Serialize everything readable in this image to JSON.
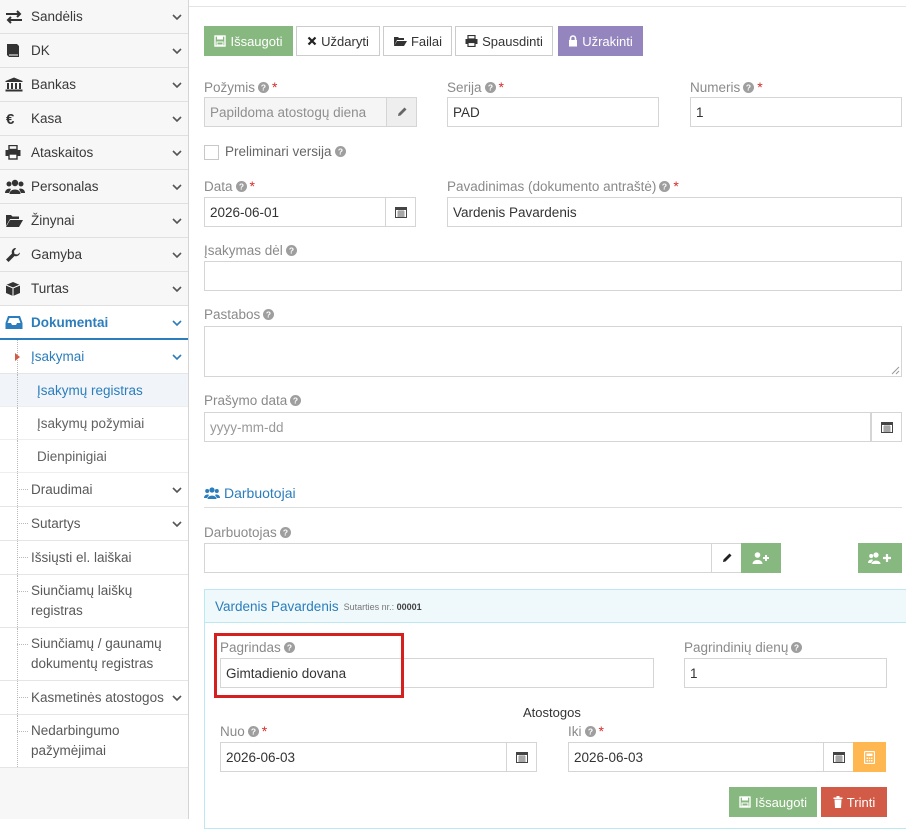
{
  "sidebar": {
    "items": [
      {
        "label": "Sandėlis",
        "icon": "exchange-icon"
      },
      {
        "label": "DK",
        "icon": "book-icon"
      },
      {
        "label": "Bankas",
        "icon": "bank-icon"
      },
      {
        "label": "Kasa",
        "icon": "euro-icon"
      },
      {
        "label": "Ataskaitos",
        "icon": "print-icon"
      },
      {
        "label": "Personalas",
        "icon": "users-icon"
      },
      {
        "label": "Žinynai",
        "icon": "folder-open-icon"
      },
      {
        "label": "Gamyba",
        "icon": "wrench-icon"
      },
      {
        "label": "Turtas",
        "icon": "cube-icon"
      },
      {
        "label": "Dokumentai",
        "icon": "inbox-icon"
      }
    ],
    "submenu": {
      "open_label": "Įsakymai",
      "children": [
        "Įsakymų registras",
        "Įsakymų požymiai",
        "Dienpinigiai"
      ],
      "items": [
        "Draudimai",
        "Sutartys",
        "Išsiųsti el. laiškai",
        "Siunčiamų laiškų registras",
        "Siunčiamų / gaunamų dokumentų registras",
        "Kasmetinės atostogos",
        "Nedarbingumo pažymėjimai"
      ]
    }
  },
  "toolbar": {
    "save": "Išsaugoti",
    "close": "Uždaryti",
    "files": "Failai",
    "print": "Spausdinti",
    "lock": "Užrakinti"
  },
  "form": {
    "pozymis": {
      "label": "Požymis",
      "value": "Papildoma atostogų diena"
    },
    "serija": {
      "label": "Serija",
      "value": "PAD"
    },
    "numeris": {
      "label": "Numeris",
      "value": "1"
    },
    "preliminari": {
      "label": "Preliminari versija",
      "checked": false
    },
    "data": {
      "label": "Data",
      "value": "2026-06-01"
    },
    "pavadinimas": {
      "label": "Pavadinimas (dokumento antraštė)",
      "value": "Vardenis Pavardenis"
    },
    "isakymas_del": {
      "label": "Įsakymas dėl",
      "value": ""
    },
    "pastabos": {
      "label": "Pastabos",
      "value": ""
    },
    "prasymo_data": {
      "label": "Prašymo data",
      "placeholder": "yyyy-mm-dd"
    }
  },
  "employees": {
    "section_title": "Darbuotojai",
    "darbuotojas_label": "Darbuotojas",
    "darbuotojas_value": ""
  },
  "employee_panel": {
    "name": "Vardenis Pavardenis",
    "contract_label": "Sutarties nr.:",
    "contract_no": "00001",
    "pagrindas": {
      "label": "Pagrindas",
      "value": "Gimtadienio dovana"
    },
    "pagrindiniu_dienu": {
      "label": "Pagrindinių dienų",
      "value": "1"
    },
    "atostogos_title": "Atostogos",
    "nuo": {
      "label": "Nuo",
      "value": "2026-06-03"
    },
    "iki": {
      "label": "Iki",
      "value": "2026-06-03"
    },
    "save": "Išsaugoti",
    "delete": "Trinti"
  },
  "colors": {
    "accent": "#2b7dbc",
    "success": "#87b87f",
    "purple": "#9585bf",
    "danger": "#d15b47",
    "warning": "#ffb752",
    "highlight": "#d62020"
  }
}
